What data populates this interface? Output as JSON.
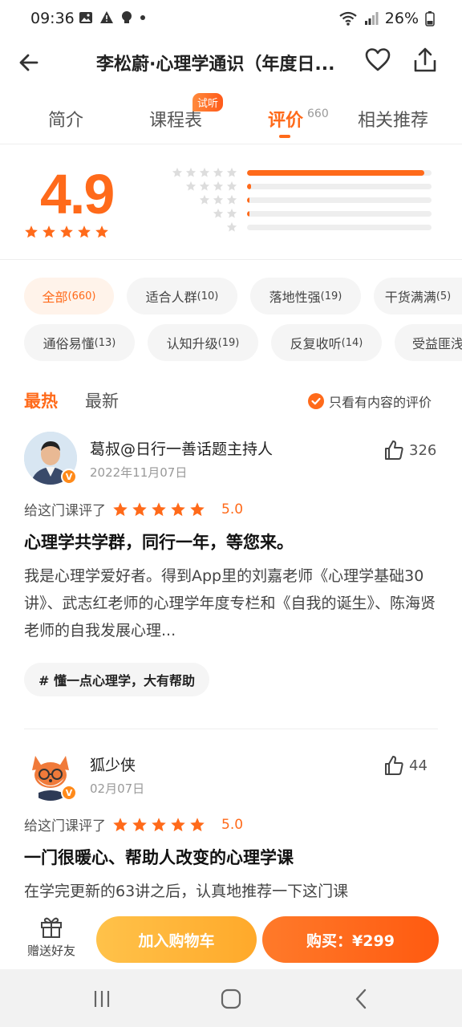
{
  "status_bar": {
    "time": "09:36",
    "battery": "26%"
  },
  "header": {
    "title": "李松蔚·心理学通识（年度日..."
  },
  "tabs": [
    {
      "label": "简介"
    },
    {
      "label": "课程表",
      "badge": "试听"
    },
    {
      "label": "评价",
      "count": "660"
    },
    {
      "label": "相关推荐"
    }
  ],
  "rating": {
    "score": "4.9",
    "distribution": [
      {
        "stars": 5,
        "fraction": 0.96
      },
      {
        "stars": 4,
        "fraction": 0.02
      },
      {
        "stars": 3,
        "fraction": 0.01
      },
      {
        "stars": 2,
        "fraction": 0.005
      },
      {
        "stars": 1,
        "fraction": 0
      }
    ]
  },
  "filters": [
    {
      "label": "全部",
      "count": "(660)",
      "active": true
    },
    {
      "label": "适合人群",
      "count": "(10)"
    },
    {
      "label": "落地性强",
      "count": "(19)"
    },
    {
      "label": "干货满满",
      "count": "(5)"
    },
    {
      "label": "通俗易懂",
      "count": "(13)"
    },
    {
      "label": "认知升级",
      "count": "(19)"
    },
    {
      "label": "反复收听",
      "count": "(14)"
    },
    {
      "label": "受益匪浅",
      "count": ""
    }
  ],
  "sort": {
    "hot": "最热",
    "new": "最新",
    "only_content": "只看有内容的评价"
  },
  "reviews": [
    {
      "name": "葛叔@日行一善话题主持人",
      "date": "2022年11月07日",
      "likes": "326",
      "rate_label": "给这门课评了",
      "rating": "5.0",
      "title": "心理学共学群，同行一年，等您来。",
      "body": "我是心理学爱好者。得到App里的刘嘉老师《心理学基础30讲》、武志红老师的心理学年度专栏和《自我的诞生》、陈海贤老师的自我发展心理...",
      "tag": "# 懂一点心理学，大有帮助",
      "verified": "V"
    },
    {
      "name": "狐少侠",
      "date": "02月07日",
      "likes": "44",
      "rate_label": "给这门课评了",
      "rating": "5.0",
      "title": "一门很暖心、帮助人改变的心理学课",
      "body": "在学完更新的63讲之后，认真地推荐一下这门课",
      "verified": "V"
    }
  ],
  "bottom": {
    "gift": "赠送好友",
    "cart": "加入购物车",
    "buy": "购买：¥299"
  },
  "colors": {
    "accent": "#ff6a1a",
    "star": "#ff6a1a",
    "star_empty": "#dddddd"
  }
}
